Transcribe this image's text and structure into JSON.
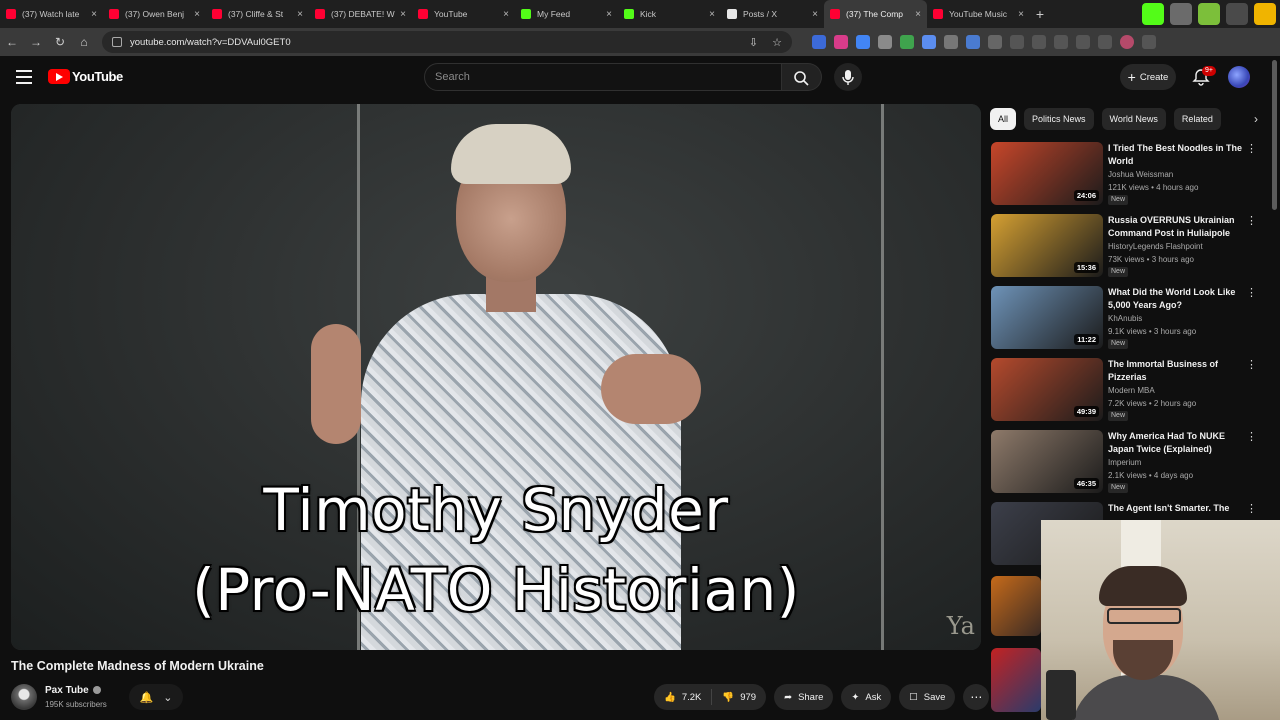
{
  "browser": {
    "tabs": [
      {
        "label": "(37) Watch late",
        "color": "#ff0033"
      },
      {
        "label": "(37) Owen Benj",
        "color": "#ff0033"
      },
      {
        "label": "(37) Cliffe & St",
        "color": "#ff0033"
      },
      {
        "label": "(37) DEBATE! W",
        "color": "#ff0033"
      },
      {
        "label": "YouTube",
        "color": "#ff0033"
      },
      {
        "label": "My Feed",
        "color": "#53fc18"
      },
      {
        "label": "Kick",
        "color": "#53fc18"
      },
      {
        "label": "Posts / X",
        "color": "#e7e7e7"
      },
      {
        "label": "(37) The Comp",
        "color": "#ff0033",
        "active": true
      },
      {
        "label": "YouTube Music",
        "color": "#ff0033"
      }
    ],
    "url": "youtube.com/watch?v=DDVAul0GET0"
  },
  "header": {
    "logo_text": "YouTube",
    "search_placeholder": "Search",
    "create_label": "Create",
    "notif_badge": "9+"
  },
  "video": {
    "caption_line1": "Timothy Snyder",
    "caption_line2": "(Pro-NATO Historian)",
    "watermark": "Ya",
    "title": "The Complete Madness of Modern Ukraine",
    "channel": "Pax Tube",
    "subscribers": "195K subscribers",
    "likes": "7.2K",
    "dislikes": "979",
    "share_label": "Share",
    "ask_label": "Ask",
    "save_label": "Save"
  },
  "sidebar": {
    "chips": [
      "All",
      "Politics News",
      "World News",
      "Related"
    ],
    "recommendations": [
      {
        "title": "I Tried The Best Noodles in The World",
        "channel": "Joshua Weissman",
        "meta": "121K views • 4 hours ago",
        "duration": "24:06",
        "new": "New",
        "thumb": "#c7462a"
      },
      {
        "title": "Russia OVERRUNS Ukrainian Command Post in Huliaipole",
        "channel": "HistoryLegends Flashpoint",
        "meta": "73K views • 3 hours ago",
        "duration": "15:36",
        "new": "New",
        "thumb": "#d5a032"
      },
      {
        "title": "What Did the World Look Like 5,000 Years Ago?",
        "channel": "KhAnubis",
        "meta": "9.1K views • 3 hours ago",
        "duration": "11:22",
        "new": "New",
        "thumb": "#6e93b8"
      },
      {
        "title": "The Immortal Business of Pizzerias",
        "channel": "Modern MBA",
        "meta": "7.2K views • 2 hours ago",
        "duration": "49:39",
        "new": "New",
        "thumb": "#b54a2d"
      },
      {
        "title": "Why America Had To NUKE Japan Twice (Explained)",
        "channel": "Imperium",
        "meta": "2.1K views • 4 days ago",
        "duration": "46:35",
        "new": "New",
        "thumb": "#8e7a6a"
      },
      {
        "title": "The Agent Isn't Smarter. The",
        "channel": "",
        "meta": "",
        "duration": "",
        "new": "",
        "thumb": "#3c3f4a"
      }
    ]
  }
}
